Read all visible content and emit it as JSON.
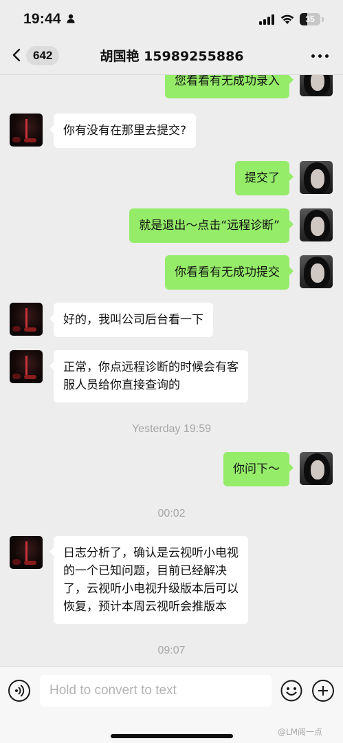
{
  "status_bar": {
    "time": "19:44",
    "battery": "35",
    "battery_level": 0.35,
    "icons": [
      "person-icon",
      "signal-icon",
      "wifi-icon",
      "battery-icon"
    ]
  },
  "nav": {
    "unread_count": "642",
    "title": "胡国艳 15989255886",
    "icons": [
      "back-chevron-icon",
      "more-dots-icon"
    ]
  },
  "messages": [
    {
      "side": "out",
      "text": "您看看有无成功录入"
    },
    {
      "side": "in",
      "text": "你有没有在那里去提交?"
    },
    {
      "side": "out",
      "text": "提交了"
    },
    {
      "side": "out",
      "text": "就是退出～点击“远程诊断”"
    },
    {
      "side": "out",
      "text": "你看看有无成功提交"
    },
    {
      "side": "in",
      "text": "好的，我叫公司后台看一下"
    },
    {
      "side": "in",
      "lines": [
        "正常，你点远程诊断的时候会有客",
        "服人员给你直接查询的"
      ]
    },
    {
      "type": "time",
      "text": "Yesterday 19:59"
    },
    {
      "side": "out",
      "text": "你问下～"
    },
    {
      "type": "time",
      "text": "00:02"
    },
    {
      "side": "in",
      "lines": [
        "日志分析了，确认是云视听小电视",
        "的一个已知问题，目前已经解决",
        "了，云视听小电视升级版本后可以",
        "恢复，预计本周云视听会推版本"
      ]
    },
    {
      "type": "time",
      "text": "09:07"
    }
  ],
  "input_bar": {
    "placeholder": "Hold to convert to text",
    "icons": [
      "voice-icon",
      "emoji-icon",
      "add-icon"
    ]
  },
  "watermark": "@LM阅一点",
  "colors": {
    "background": "#ededed",
    "outgoing_bubble": "#95ec69",
    "incoming_bubble": "#ffffff",
    "timestamp": "#a6a6a6"
  }
}
